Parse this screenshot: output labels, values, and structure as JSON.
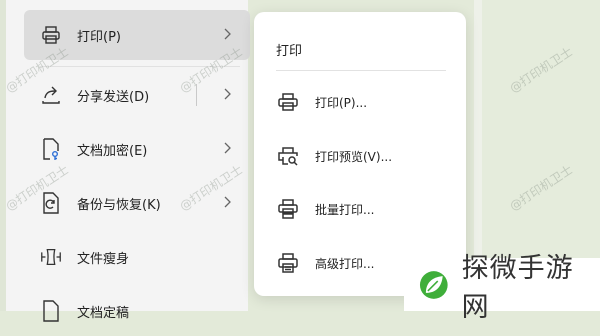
{
  "menu": {
    "items": [
      {
        "label": "打印(P)",
        "icon": "printer-icon",
        "has_submenu": true,
        "active": true
      },
      {
        "label": "分享发送(D)",
        "icon": "share-icon",
        "has_submenu": true
      },
      {
        "label": "文档加密(E)",
        "icon": "document-lock-icon",
        "has_submenu": true
      },
      {
        "label": "备份与恢复(K)",
        "icon": "backup-icon",
        "has_submenu": true
      },
      {
        "label": "文件瘦身",
        "icon": "file-compress-icon",
        "has_submenu": false
      },
      {
        "label": "文档定稿",
        "icon": "document-final-icon",
        "has_submenu": false
      }
    ]
  },
  "submenu": {
    "title": "打印",
    "items": [
      {
        "label": "打印(P)...",
        "icon": "printer-icon"
      },
      {
        "label": "打印预览(V)...",
        "icon": "print-preview-icon"
      },
      {
        "label": "批量打印...",
        "icon": "batch-print-icon"
      },
      {
        "label": "高级打印...",
        "icon": "advanced-print-icon"
      }
    ]
  },
  "watermark": {
    "text": "@打印机卫士"
  },
  "logo": {
    "text": "探微手游网"
  },
  "colors": {
    "accent_green": "#3fae3a",
    "background": "#e3ead9",
    "active_item": "#dcdcdc"
  }
}
